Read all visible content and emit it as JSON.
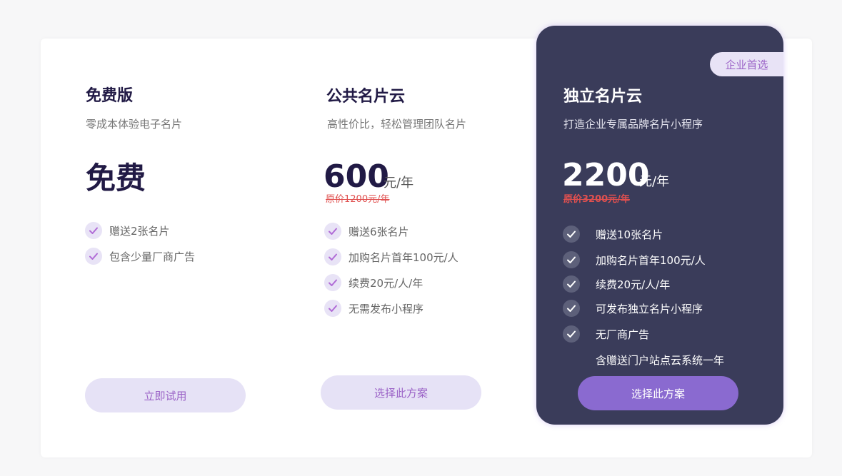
{
  "plans": [
    {
      "title": "免费版",
      "subtitle": "零成本体验电子名片",
      "price": "免费",
      "features": [
        "赠送2张名片",
        "包含少量厂商广告"
      ],
      "button": "立即试用"
    },
    {
      "title": "公共名片云",
      "subtitle": "高性价比，轻松管理团队名片",
      "price": "600",
      "unit": "元/年",
      "original_price": "原价1200元/年",
      "features": [
        "赠送6张名片",
        "加购名片首年100元/人",
        "续费20元/人/年",
        "无需发布小程序"
      ],
      "button": "选择此方案"
    },
    {
      "badge": "企业首选",
      "title": "独立名片云",
      "subtitle": "打造企业专属品牌名片小程序",
      "price": "2200",
      "unit": "元/年",
      "original_price": "原价3200元/年",
      "features": [
        "赠送10张名片",
        "加购名片首年100元/人",
        "续费20元/人/年",
        "可发布独立名片小程序",
        "无厂商广告"
      ],
      "extra_feature": "含赠送门户站点云系统一年",
      "button": "选择此方案"
    }
  ],
  "icons": {
    "feature_check": "check-icon"
  },
  "colors": {
    "accent_purple": "#9b63c7",
    "featured_bg": "#3a3c5a",
    "primary_button": "#8a6ad0",
    "light_button": "#e6e2f6",
    "strike_price": "#e0504f",
    "title_dark": "#211a45"
  }
}
